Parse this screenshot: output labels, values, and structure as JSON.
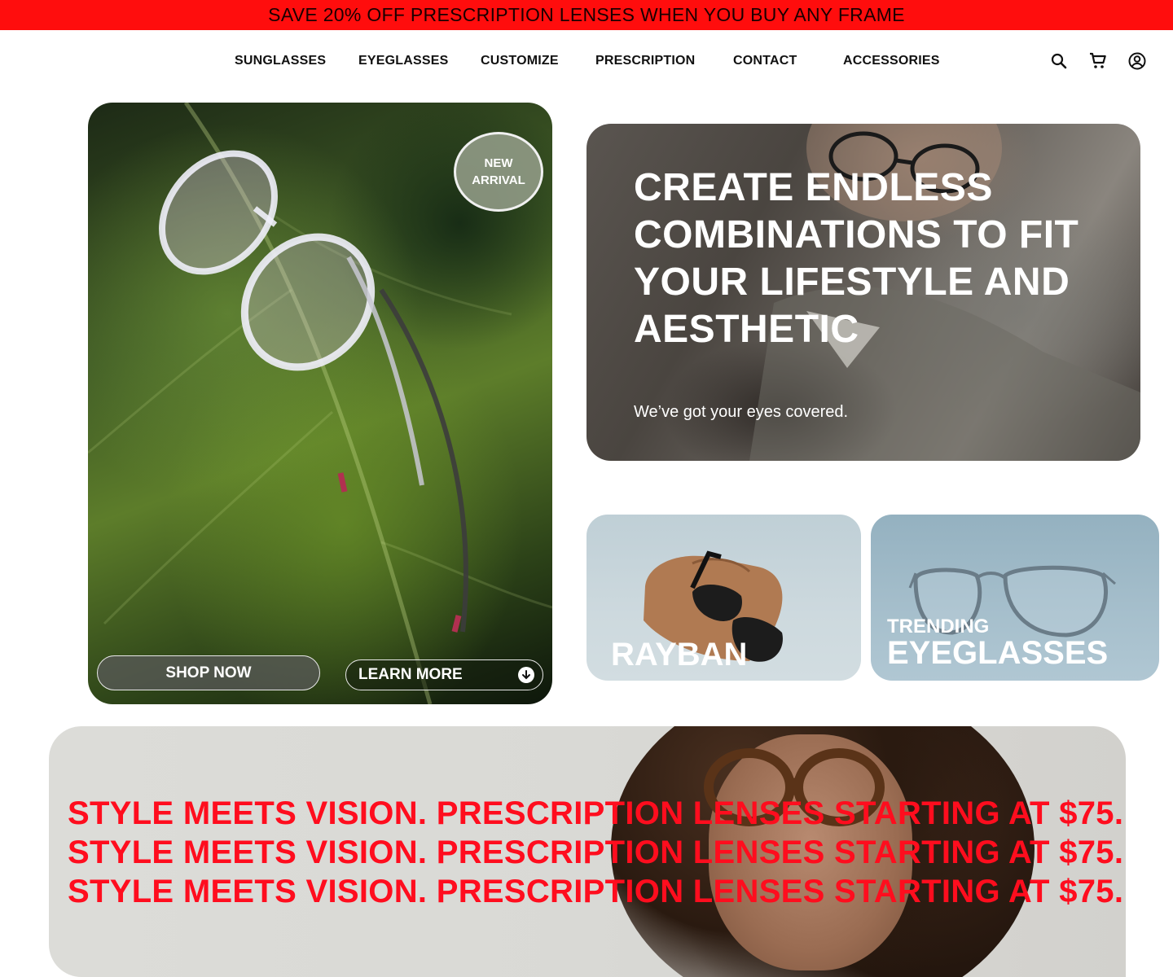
{
  "promo": {
    "text": "SAVE 20% OFF PRESCRIPTION LENSES WHEN YOU BUY ANY FRAME"
  },
  "nav": {
    "items": [
      {
        "label": "SUNGLASSES"
      },
      {
        "label": "EYEGLASSES"
      },
      {
        "label": "CUSTOMIZE"
      },
      {
        "label": "PRESCRIPTION"
      },
      {
        "label": "CONTACT"
      },
      {
        "label": "ACCESSORIES"
      }
    ],
    "icons": [
      "search-icon",
      "cart-icon",
      "account-icon"
    ]
  },
  "hero_left": {
    "badge_line1": "NEW",
    "badge_line2": "ARRIVAL",
    "shop_label": "SHOP NOW",
    "learn_label": "LEARN MORE"
  },
  "hero_right": {
    "title": "CREATE ENDLESS COMBINATIONS TO FIT YOUR LIFESTYLE AND AESTHETIC",
    "subtitle": "We’ve got your eyes covered."
  },
  "cards": {
    "rayban": {
      "title": "RAYBAN"
    },
    "trending": {
      "kicker": "TRENDING",
      "title": "EYEGLASSES"
    }
  },
  "banner": {
    "lines": [
      "STYLE MEETS VISION. PRESCRIPTION LENSES STARTING AT $75.",
      "STYLE MEETS VISION. PRESCRIPTION LENSES STARTING AT $75.",
      "STYLE MEETS VISION. PRESCRIPTION LENSES STARTING AT $75."
    ]
  },
  "colors": {
    "accent_red": "#ff0d0d",
    "banner_text": "#ff0d1e"
  }
}
